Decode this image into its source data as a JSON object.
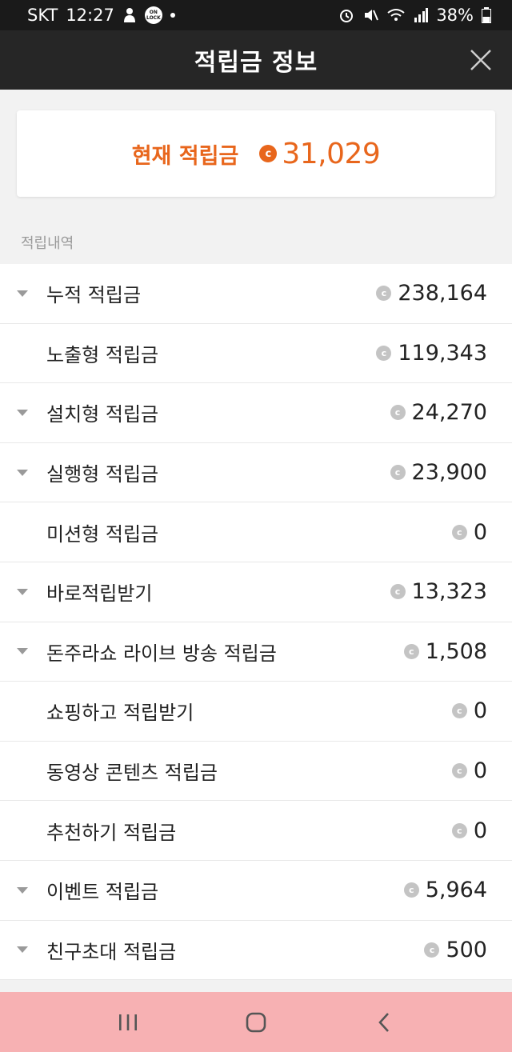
{
  "status_bar": {
    "carrier": "SKT",
    "time": "12:27",
    "lock_badge": "ON LOCK",
    "battery": "38%"
  },
  "header": {
    "title": "적립금 정보"
  },
  "balance": {
    "label": "현재 적립금",
    "coin_symbol": "c",
    "value": "31,029"
  },
  "section_label": "적립내역",
  "coin_symbol": "c",
  "history": [
    {
      "label": "누적 적립금",
      "amount": "238,164",
      "expandable": true
    },
    {
      "label": "노출형 적립금",
      "amount": "119,343",
      "expandable": false
    },
    {
      "label": "설치형 적립금",
      "amount": "24,270",
      "expandable": true
    },
    {
      "label": "실행형 적립금",
      "amount": "23,900",
      "expandable": true
    },
    {
      "label": "미션형 적립금",
      "amount": "0",
      "expandable": false
    },
    {
      "label": "바로적립받기",
      "amount": "13,323",
      "expandable": true
    },
    {
      "label": "돈주라쇼 라이브 방송 적립금",
      "amount": "1,508",
      "expandable": true
    },
    {
      "label": "쇼핑하고 적립받기",
      "amount": "0",
      "expandable": false
    },
    {
      "label": "동영상 콘텐츠 적립금",
      "amount": "0",
      "expandable": false
    },
    {
      "label": "추천하기 적립금",
      "amount": "0",
      "expandable": false
    },
    {
      "label": "이벤트 적립금",
      "amount": "5,964",
      "expandable": true
    },
    {
      "label": "친구초대 적립금",
      "amount": "500",
      "expandable": true
    }
  ],
  "icons": {
    "close": "close-icon",
    "caret": "caret-down-icon",
    "nav_recent": "recent-apps-icon",
    "nav_home": "home-icon",
    "nav_back": "back-icon"
  },
  "colors": {
    "accent": "#e8661c",
    "app_bar": "#262626",
    "nav_bar": "#f7b1b3",
    "coin_grey": "#c4c4c4"
  }
}
